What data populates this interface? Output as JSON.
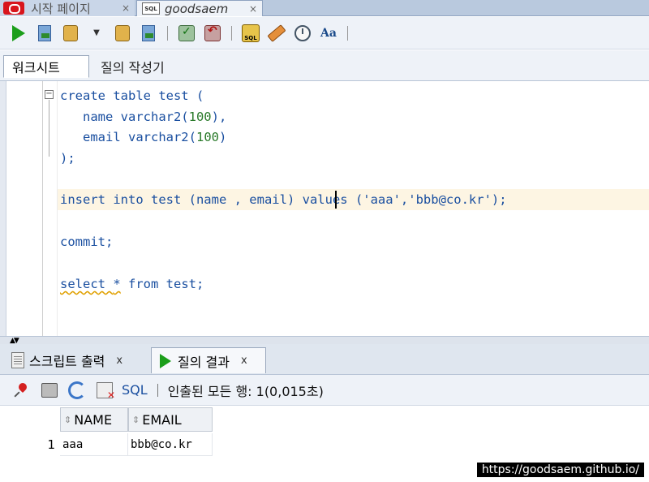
{
  "tabs": {
    "start_page": "시작 페이지",
    "connection": "goodsaem"
  },
  "icons": {
    "close": "×",
    "sql_badge": "SQL"
  },
  "subtabs": {
    "worksheet": "워크시트",
    "query_builder": "질의 작성기"
  },
  "editor": {
    "lines": [
      {
        "kw": "create table test ("
      },
      {
        "pre": "   name varchar2(",
        "num": "100",
        "post": "),"
      },
      {
        "pre": "   email varchar2(",
        "num": "100",
        "post": ")"
      },
      {
        "kw": ");"
      },
      {
        "kw": "insert into test (name , email) values ('aaa','bbb@co.kr');"
      },
      {
        "kw": "commit;"
      },
      {
        "a": "select ",
        "star": "*",
        "b": " from test;"
      }
    ]
  },
  "bottom_tabs": {
    "script_output": "스크립트 출력",
    "query_result": "질의 결과",
    "close": "x"
  },
  "results_toolbar": {
    "sql_link": "SQL",
    "status": "인출된 모든 행: 1(0,015초)"
  },
  "results_grid": {
    "columns": [
      "NAME",
      "EMAIL"
    ],
    "rows": [
      {
        "row_num": "1",
        "values": [
          "aaa",
          "bbb@co.kr"
        ]
      }
    ]
  },
  "watermark": "https://goodsaem.github.io/",
  "colors": {
    "keyword": "#1a4fa0",
    "number": "#2a7a2a",
    "run_green": "#1b9e1b",
    "current_line": "#fdf5e3"
  }
}
